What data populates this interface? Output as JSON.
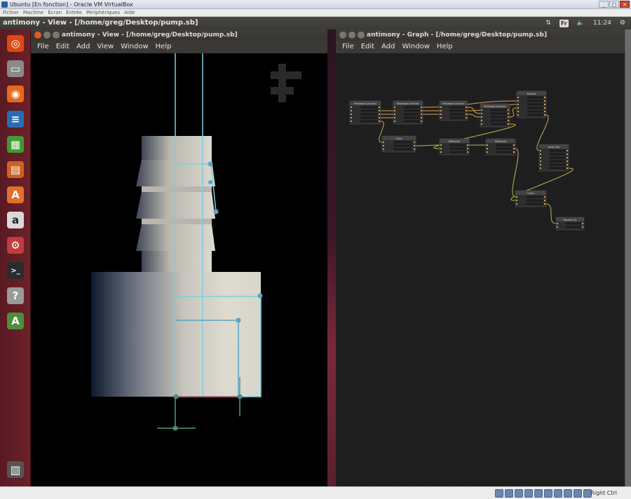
{
  "vbox": {
    "title": "Ubuntu [En fonction] - Oracle VM VirtualBox",
    "menu": [
      "Fichier",
      "Machine",
      "Écran",
      "Entrée",
      "Périphériques",
      "Aide"
    ],
    "status_hostkey": "Right Ctrl"
  },
  "panel": {
    "app_title": "antimony - View - [/home/greg/Desktop/pump.sb]",
    "keyboard_layout": "Fr",
    "time": "11:24"
  },
  "launcher": {
    "items": [
      {
        "name": "dash-home",
        "glyph": "◎",
        "color": "#dd4814"
      },
      {
        "name": "files",
        "glyph": "▭",
        "color": "#8a8a88"
      },
      {
        "name": "firefox",
        "glyph": "◉",
        "color": "#e66a1c"
      },
      {
        "name": "libreoffice-writer",
        "glyph": "≡",
        "color": "#2a6db5"
      },
      {
        "name": "libreoffice-calc",
        "glyph": "▦",
        "color": "#3f9a35"
      },
      {
        "name": "libreoffice-impress",
        "glyph": "▤",
        "color": "#d0621f"
      },
      {
        "name": "software-center",
        "glyph": "A",
        "color": "#e0702a"
      },
      {
        "name": "amazon",
        "glyph": "a",
        "color": "#d9d9d9"
      },
      {
        "name": "system-settings",
        "glyph": "⚙",
        "color": "#c23b3b"
      },
      {
        "name": "terminal",
        "glyph": ">_",
        "color": "#2b2b2b"
      },
      {
        "name": "help",
        "glyph": "?",
        "color": "#9a9a9a"
      },
      {
        "name": "software-updater",
        "glyph": "A",
        "color": "#4d8f3a"
      }
    ],
    "trash": {
      "name": "trash",
      "glyph": "🗑",
      "color": "#8a8a88"
    }
  },
  "view_window": {
    "title": "antimony - View - [/home/greg/Desktop/pump.sb]",
    "menu": [
      "File",
      "Edit",
      "Add",
      "View",
      "Window",
      "Help"
    ]
  },
  "graph_window": {
    "title": "antimony - Graph - [/home/greg/Desktop/pump.sb]",
    "menu": [
      "File",
      "Edit",
      "Add",
      "Window",
      "Help"
    ]
  },
  "graph": {
    "nodes": [
      {
        "id": "n1",
        "title": "Rectangle (circular)",
        "rows": 5
      },
      {
        "id": "n2",
        "title": "Rectangle (circular)",
        "rows": 5
      },
      {
        "id": "n3",
        "title": "Rectangle (circular)",
        "rows": 4
      },
      {
        "id": "n4",
        "title": "Rectangle (circular)",
        "rows": 5
      },
      {
        "id": "n5",
        "title": "Extrude",
        "rows": 6
      },
      {
        "id": "n6",
        "title": "Union",
        "rows": 3
      },
      {
        "id": "n7",
        "title": "Difference",
        "rows": 3
      },
      {
        "id": "n8",
        "title": "Difference",
        "rows": 3
      },
      {
        "id": "n9",
        "title": "Array (2D)",
        "rows": 6
      },
      {
        "id": "n10",
        "title": "Union",
        "rows": 3
      },
      {
        "id": "n11",
        "title": "Revolve (Y)",
        "rows": 2
      }
    ]
  },
  "colors": {
    "accent_cyan": "#7ccfe0",
    "handle_blue": "#5aa3c4",
    "wire_orange": "#e0a050",
    "wire_olive": "#b9b74e",
    "ubuntu_orange": "#dd4814"
  }
}
